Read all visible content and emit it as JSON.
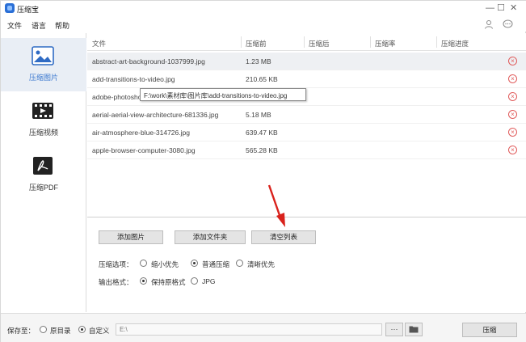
{
  "app": {
    "title": "压缩宝"
  },
  "window_controls": {
    "minimize": "—",
    "maximize": "☐",
    "close": "✕"
  },
  "menu": {
    "items": [
      "文件",
      "语言",
      "帮助"
    ]
  },
  "sidebar": {
    "items": [
      {
        "label": "压缩图片",
        "icon": "image-icon",
        "active": true
      },
      {
        "label": "压缩视频",
        "icon": "film-icon",
        "active": false
      },
      {
        "label": "压缩PDF",
        "icon": "pdf-icon",
        "active": false
      }
    ]
  },
  "table": {
    "columns": [
      "文件",
      "压缩前",
      "压缩后",
      "压缩率",
      "压缩进度"
    ],
    "rows": [
      {
        "name": "abstract-art-background-1037999.jpg",
        "size": "1.23 MB"
      },
      {
        "name": "add-transitions-to-video.jpg",
        "size": "210.65 KB"
      },
      {
        "name": "adobe-photoshop",
        "size": ""
      },
      {
        "name": "aerial-aerial-view-architecture-681336.jpg",
        "size": "5.18 MB"
      },
      {
        "name": "air-atmosphere-blue-314726.jpg",
        "size": "639.47 KB"
      },
      {
        "name": "apple-browser-computer-3080.jpg",
        "size": "565.28 KB"
      }
    ],
    "tooltip": "F:\\work\\素材库\\图片库\\add-transitions-to-video.jpg"
  },
  "actions": {
    "add_images": "添加图片",
    "add_folder": "添加文件夹",
    "clear_list": "清空列表"
  },
  "compress_options": {
    "label": "压缩选项：",
    "options": [
      "缩小优先",
      "普通压缩",
      "清晰优先"
    ],
    "selected": "普通压缩"
  },
  "output_format": {
    "label": "输出格式：",
    "options": [
      "保持原格式",
      "JPG"
    ],
    "selected": "保持原格式"
  },
  "footer": {
    "save_to_label": "保存至：",
    "options": [
      "原目录",
      "自定义"
    ],
    "selected": "自定义",
    "path": "E:\\",
    "more": "···",
    "compress_button": "压缩"
  },
  "colors": {
    "accent": "#3a78d0",
    "delete": "#e05a5a",
    "arrow": "#d9221c"
  }
}
